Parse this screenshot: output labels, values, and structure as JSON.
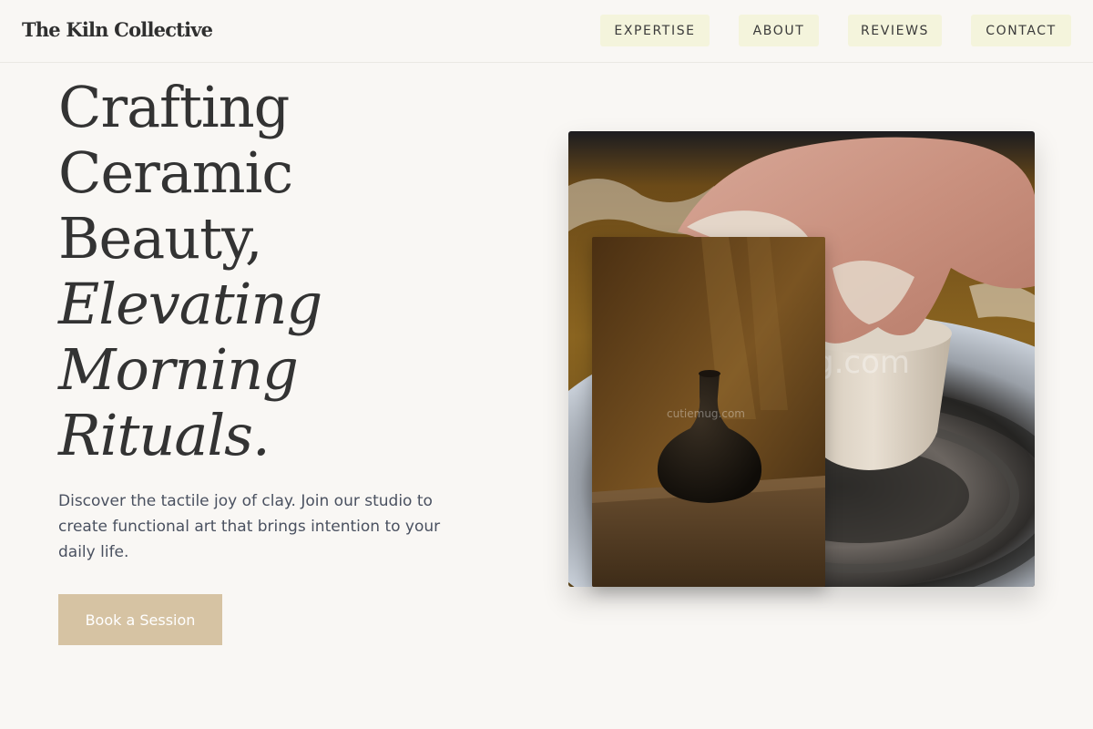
{
  "header": {
    "logo": "The Kiln Collective",
    "nav": [
      {
        "label": "EXPERTISE"
      },
      {
        "label": "ABOUT"
      },
      {
        "label": "REVIEWS"
      },
      {
        "label": "CONTACT"
      }
    ]
  },
  "hero": {
    "title_lines": [
      "Crafting",
      "Ceramic",
      "Beauty,"
    ],
    "title_italic_lines": [
      "Elevating",
      "Morning",
      "Rituals."
    ],
    "description": "Discover the tactile joy of clay. Join our studio to create functional art that brings intention to your daily life.",
    "cta_label": "Book a Session"
  },
  "images": {
    "main_alt": "Hands shaping clay on a pottery wheel",
    "main_watermark": "g.com",
    "secondary_alt": "Dark ceramic vase on a draped table",
    "secondary_watermark": "cutiemug.com"
  },
  "colors": {
    "background": "#f9f7f4",
    "nav_button": "#f4f4dc",
    "cta": "#d6c3a3",
    "text": "#333333",
    "body_text": "#4a5160"
  }
}
